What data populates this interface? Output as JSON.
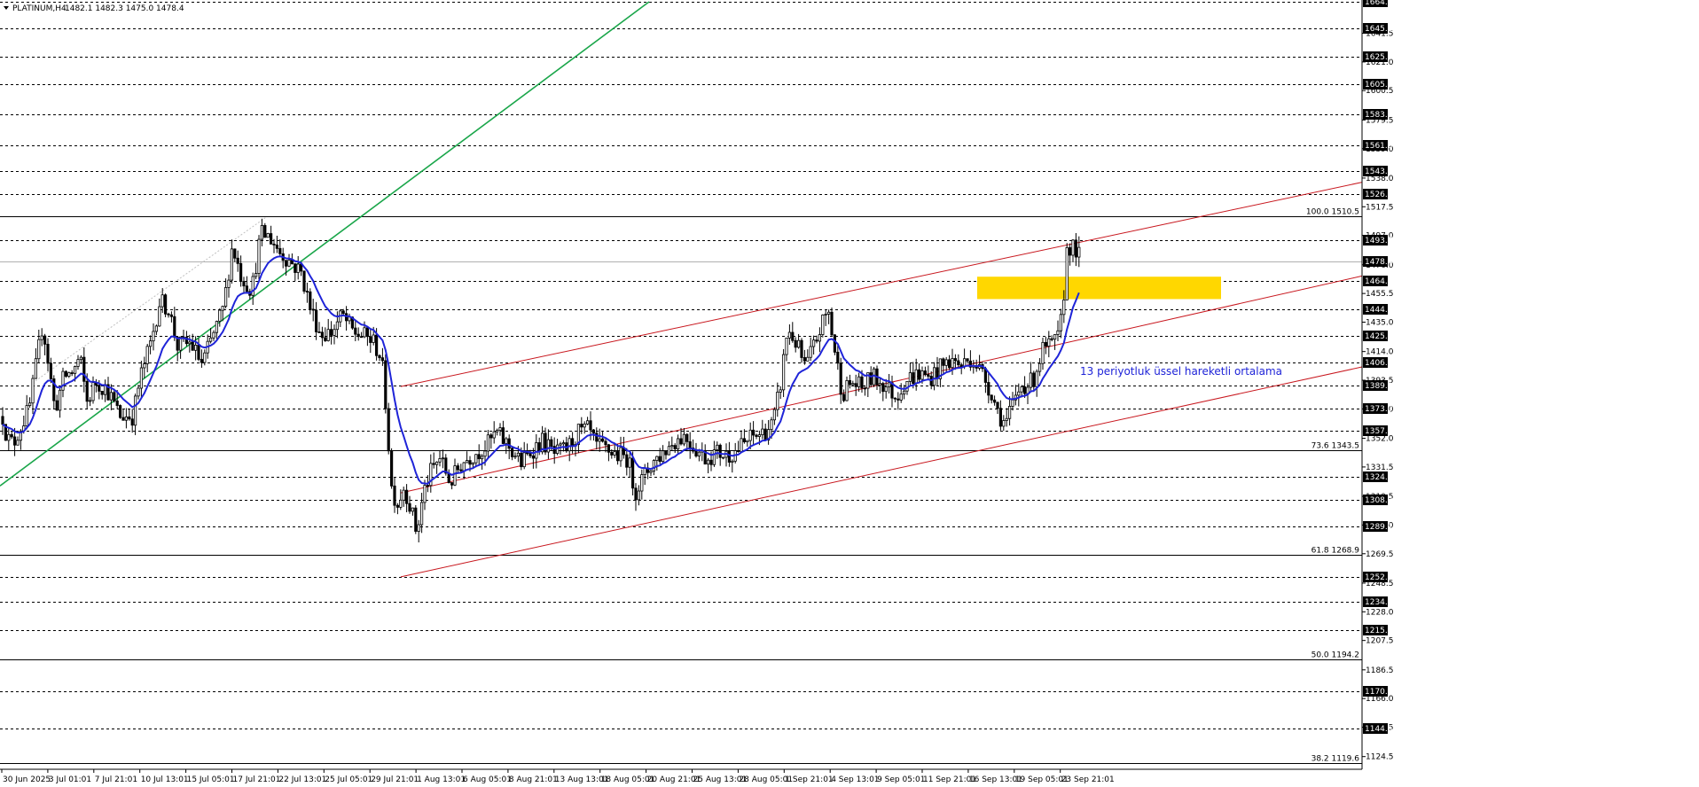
{
  "chart_data": {
    "type": "candlestick",
    "symbol": "PLATINUM,H4",
    "ohlc": "1482.1 1482.3 1475.0 1478.4",
    "x_tick_labels": [
      "30 Jun 2025",
      "3 Jul 01:01",
      "7 Jul 21:01",
      "10 Jul 13:01",
      "15 Jul 05:01",
      "17 Jul 21:01",
      "22 Jul 13:01",
      "25 Jul 05:01",
      "29 Jul 21:01",
      "1 Aug 13:01",
      "6 Aug 05:01",
      "8 Aug 21:01",
      "13 Aug 13:01",
      "18 Aug 05:01",
      "20 Aug 21:01",
      "25 Aug 13:01",
      "28 Aug 05:01",
      "1 Sep 21:01",
      "4 Sep 13:01",
      "9 Sep 05:01",
      "11 Sep 21:01",
      "16 Sep 13:01",
      "19 Sep 05:01",
      "23 Sep 21:01"
    ],
    "y_tick_labels": [
      "1641.5",
      "1621.0",
      "1600.5",
      "1579.5",
      "1559.0",
      "1538.0",
      "1517.5",
      "1497.0",
      "1476.0",
      "1455.5",
      "1435.0",
      "1414.0",
      "1393.5",
      "1373.0",
      "1352.0",
      "1331.5",
      "1310.5",
      "1290.0",
      "1269.5",
      "1248.5",
      "1228.0",
      "1207.5",
      "1186.5",
      "1166.0",
      "1145.5",
      "1124.5"
    ],
    "ylim": [
      1116.7,
      1664.0
    ],
    "price_levels": [
      "1664.0",
      "1645.1",
      "1625.0",
      "1605.1",
      "1583.3",
      "1561.5",
      "1543.1",
      "1526.3",
      "1493.7",
      "1478.4",
      "1464.5",
      "1444.0",
      "1425.2",
      "1406.1",
      "1389.9",
      "1373.0",
      "1357.5",
      "1324.7",
      "1308.3",
      "1289.1",
      "1252.9",
      "1234.9",
      "1215.2",
      "1170.9",
      "1144.5"
    ],
    "current_price": "1478.4",
    "fib_levels": [
      {
        "label": "100.0 1510.5",
        "price": 1510.5
      },
      {
        "label": "73.6 1343.5",
        "price": 1343.5
      },
      {
        "label": "61.8 1268.9",
        "price": 1268.9
      },
      {
        "label": "50.0 1194.2",
        "price": 1194.2
      },
      {
        "label": "38.2 1119.6",
        "price": 1119.6
      }
    ],
    "ema_label": "13 periyotluk üssel hareketli ortalama",
    "anchor_points": [
      [
        0,
        1377
      ],
      [
        8,
        1352
      ],
      [
        15,
        1348
      ],
      [
        23,
        1360
      ],
      [
        33,
        1373
      ],
      [
        41,
        1405
      ],
      [
        48,
        1434
      ],
      [
        55,
        1404
      ],
      [
        62,
        1372
      ],
      [
        72,
        1396
      ],
      [
        83,
        1400
      ],
      [
        90,
        1410
      ],
      [
        98,
        1378
      ],
      [
        108,
        1392
      ],
      [
        120,
        1388
      ],
      [
        135,
        1368
      ],
      [
        150,
        1368
      ],
      [
        158,
        1395
      ],
      [
        170,
        1420
      ],
      [
        180,
        1450
      ],
      [
        190,
        1445
      ],
      [
        200,
        1418
      ],
      [
        215,
        1420
      ],
      [
        228,
        1405
      ],
      [
        240,
        1425
      ],
      [
        252,
        1445
      ],
      [
        262,
        1490
      ],
      [
        272,
        1468
      ],
      [
        284,
        1458
      ],
      [
        294,
        1498
      ],
      [
        304,
        1496
      ],
      [
        316,
        1485
      ],
      [
        328,
        1478
      ],
      [
        340,
        1470
      ],
      [
        350,
        1445
      ],
      [
        362,
        1426
      ],
      [
        374,
        1428
      ],
      [
        386,
        1440
      ],
      [
        398,
        1428
      ],
      [
        410,
        1425
      ],
      [
        420,
        1422
      ],
      [
        430,
        1410
      ],
      [
        436,
        1370
      ],
      [
        441,
        1318
      ],
      [
        448,
        1305
      ],
      [
        456,
        1318
      ],
      [
        464,
        1300
      ],
      [
        470,
        1284
      ],
      [
        478,
        1314
      ],
      [
        486,
        1328
      ],
      [
        496,
        1338
      ],
      [
        508,
        1320
      ],
      [
        520,
        1334
      ],
      [
        532,
        1340
      ],
      [
        548,
        1346
      ],
      [
        560,
        1356
      ],
      [
        574,
        1346
      ],
      [
        588,
        1334
      ],
      [
        600,
        1344
      ],
      [
        612,
        1350
      ],
      [
        626,
        1340
      ],
      [
        640,
        1345
      ],
      [
        652,
        1356
      ],
      [
        664,
        1358
      ],
      [
        672,
        1346
      ],
      [
        684,
        1344
      ],
      [
        696,
        1340
      ],
      [
        708,
        1338
      ],
      [
        716,
        1314
      ],
      [
        724,
        1322
      ],
      [
        736,
        1335
      ],
      [
        748,
        1342
      ],
      [
        760,
        1350
      ],
      [
        772,
        1354
      ],
      [
        784,
        1345
      ],
      [
        796,
        1338
      ],
      [
        808,
        1342
      ],
      [
        820,
        1340
      ],
      [
        832,
        1344
      ],
      [
        846,
        1352
      ],
      [
        860,
        1356
      ],
      [
        872,
        1362
      ],
      [
        880,
        1390
      ],
      [
        888,
        1430
      ],
      [
        898,
        1420
      ],
      [
        908,
        1402
      ],
      [
        918,
        1418
      ],
      [
        926,
        1432
      ],
      [
        934,
        1444
      ],
      [
        942,
        1412
      ],
      [
        950,
        1384
      ],
      [
        960,
        1392
      ],
      [
        972,
        1388
      ],
      [
        984,
        1396
      ],
      [
        998,
        1390
      ],
      [
        1010,
        1382
      ],
      [
        1022,
        1394
      ],
      [
        1036,
        1398
      ],
      [
        1048,
        1395
      ],
      [
        1060,
        1402
      ],
      [
        1072,
        1408
      ],
      [
        1084,
        1404
      ],
      [
        1096,
        1410
      ],
      [
        1108,
        1398
      ],
      [
        1118,
        1385
      ],
      [
        1126,
        1370
      ],
      [
        1134,
        1362
      ],
      [
        1142,
        1375
      ],
      [
        1152,
        1390
      ],
      [
        1164,
        1392
      ],
      [
        1176,
        1415
      ],
      [
        1186,
        1418
      ],
      [
        1194,
        1424
      ],
      [
        1199,
        1446
      ],
      [
        1202,
        1485
      ],
      [
        1206,
        1490
      ],
      [
        1212,
        1486
      ],
      [
        1216,
        1484
      ],
      [
        1220,
        1478
      ]
    ]
  }
}
